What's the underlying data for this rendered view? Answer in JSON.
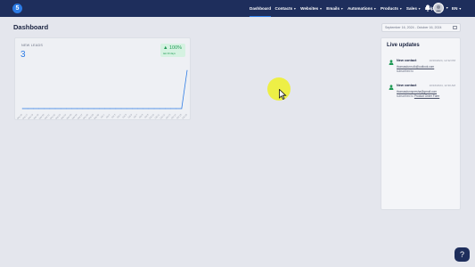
{
  "header": {
    "logo_text": "5",
    "nav": [
      {
        "label": "Dashboard",
        "active": true,
        "has_chevron": false
      },
      {
        "label": "Contacts",
        "active": false,
        "has_chevron": true
      },
      {
        "label": "Websites",
        "active": false,
        "has_chevron": true
      },
      {
        "label": "Emails",
        "active": false,
        "has_chevron": true
      },
      {
        "label": "Automations",
        "active": false,
        "has_chevron": true
      },
      {
        "label": "Products",
        "active": false,
        "has_chevron": true
      },
      {
        "label": "Sales",
        "active": false,
        "has_chevron": true
      },
      {
        "label": "Help",
        "active": false,
        "has_chevron": false
      }
    ],
    "language": "EN",
    "icons": [
      "bell-icon",
      "avatar",
      "chevron-down-icon"
    ]
  },
  "page": {
    "title": "Dashboard",
    "date_range": "September 16, 2024 - October 16, 2024"
  },
  "leads_card": {
    "label": "NEW LEADS",
    "value": "3",
    "change_pct": "100%",
    "change_sub": "last 30 days",
    "change_direction": "up"
  },
  "chart_data": {
    "type": "line",
    "x": [
      "Sep 16",
      "Sep 17",
      "Sep 18",
      "Sep 19",
      "Sep 20",
      "Sep 21",
      "Sep 22",
      "Sep 23",
      "Sep 24",
      "Sep 25",
      "Sep 26",
      "Sep 27",
      "Sep 28",
      "Sep 29",
      "Sep 30",
      "Oct 1",
      "Oct 2",
      "Oct 3",
      "Oct 4",
      "Oct 5",
      "Oct 6",
      "Oct 7",
      "Oct 8",
      "Oct 9",
      "Oct 10",
      "Oct 11",
      "Oct 12",
      "Oct 13",
      "Oct 14",
      "Oct 15",
      "Oct 16"
    ],
    "values": [
      0,
      0,
      0,
      0,
      0,
      0,
      0,
      0,
      0,
      0,
      0,
      0,
      0,
      0,
      0,
      0,
      0,
      0,
      0,
      0,
      0,
      0,
      0,
      0,
      0,
      0,
      0,
      0,
      0,
      0,
      3
    ],
    "ylim": [
      0,
      3
    ],
    "color": "#2c7be5",
    "grid": false
  },
  "live_updates": {
    "title": "Live updates",
    "items": [
      {
        "name": "New contact",
        "time": "10/16/2024, 12:32 PM",
        "email": "thomasdunn.dk@outlook.com",
        "sub_text": "subscribed to",
        "sub_link": ""
      },
      {
        "name": "New contact",
        "time": "10/16/2024, 12:30 AM",
        "email": "thomasdunnpresha@gmail.com",
        "sub_text": "subscribed to",
        "sub_link": "Product Order Form"
      }
    ]
  },
  "help_button": {
    "label": "?"
  },
  "colors": {
    "topbar": "#1e2e5c",
    "accent": "#2c7be5",
    "success": "#1f9a55",
    "background": "#e4e6ed"
  }
}
